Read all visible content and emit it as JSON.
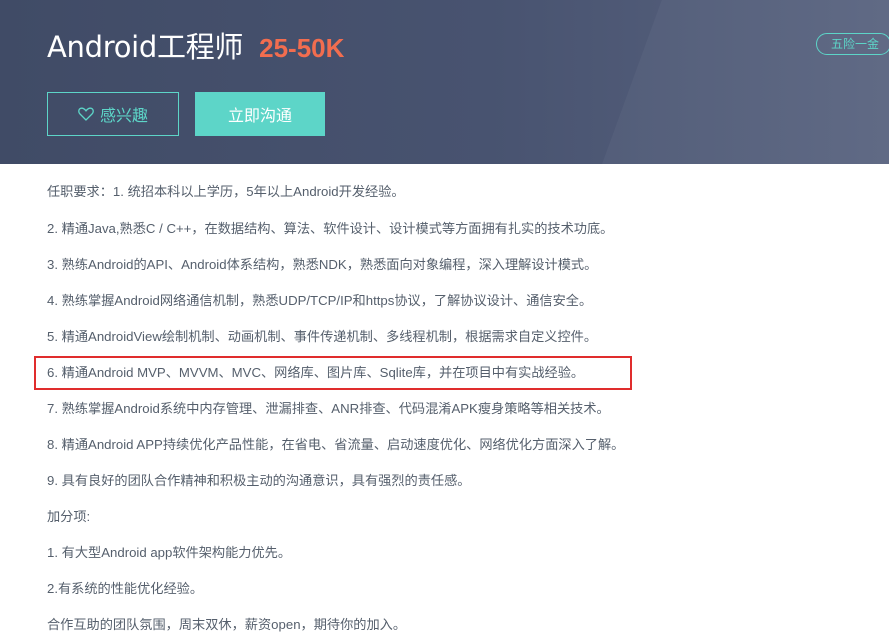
{
  "header": {
    "job_title": "Android工程师",
    "salary": "25-50K",
    "benefit_tag": "五险一金",
    "interest_label": "感兴趣",
    "chat_label": "立即沟通"
  },
  "description": {
    "lines": [
      "任职要求：1. 统招本科以上学历，5年以上Android开发经验。",
      "2. 精通Java,熟悉C / C++，在数据结构、算法、软件设计、设计模式等方面拥有扎实的技术功底。",
      "3. 熟练Android的API、Android体系结构，熟悉NDK，熟悉面向对象编程，深入理解设计模式。",
      "4. 熟练掌握Android网络通信机制，熟悉UDP/TCP/IP和https协议，了解协议设计、通信安全。",
      "5. 精通AndroidView绘制机制、动画机制、事件传递机制、多线程机制，根据需求自定义控件。",
      "6. 精通Android MVP、MVVM、MVC、网络库、图片库、Sqlite库，并在项目中有实战经验。",
      "7. 熟练掌握Android系统中内存管理、泄漏排查、ANR排查、代码混淆APK瘦身策略等相关技术。",
      "8. 精通Android APP持续优化产品性能，在省电、省流量、启动速度优化、网络优化方面深入了解。",
      "9. 具有良好的团队合作精神和积极主动的沟通意识，具有强烈的责任感。",
      "加分项:",
      "1. 有大型Android app软件架构能力优先。",
      "2.有系统的性能优化经验。",
      "合作互助的团队氛围，周末双休，薪资open，期待你的加入。"
    ]
  },
  "colors": {
    "header_bg": "#434d69",
    "accent": "#5dd5c8",
    "salary": "#f26d4f",
    "highlight_border": "#e02d2d",
    "body_text": "#555f6c"
  },
  "icons": {
    "interest": "heart-outline-icon"
  }
}
